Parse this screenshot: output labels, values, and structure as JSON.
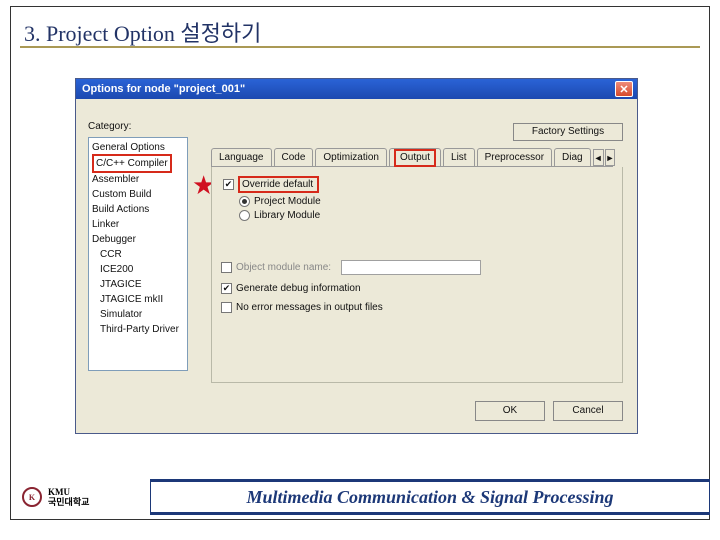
{
  "header": {
    "title": "3. Project Option 설정하기"
  },
  "dialog": {
    "title": "Options for node \"project_001\"",
    "factory_btn": "Factory Settings",
    "category_label": "Category:"
  },
  "categories": [
    "General Options",
    "C/C++ Compiler",
    "Assembler",
    "Custom Build",
    "Build Actions",
    "Linker",
    "Debugger",
    "CCR",
    "ICE200",
    "JTAGICE",
    "JTAGICE mkII",
    "Simulator",
    "Third-Party Driver"
  ],
  "tabs": {
    "t1": "Language",
    "t2": "Code",
    "t3": "Optimization",
    "t4": "Output",
    "t5": "List",
    "t6": "Preprocessor",
    "t7": "Diag"
  },
  "panel": {
    "override": "Override default",
    "r1": "Project Module",
    "r2": "Library Module",
    "chk_obj": "Object module name:",
    "chk_dbg": "Generate debug information",
    "chk_err": "No error messages in output files"
  },
  "buttons": {
    "ok": "OK",
    "cancel": "Cancel"
  },
  "footer": {
    "logo_text_top": "KMU",
    "logo_text_bottom": "국민대학교",
    "bar": "Multimedia Communication & Signal Processing"
  }
}
